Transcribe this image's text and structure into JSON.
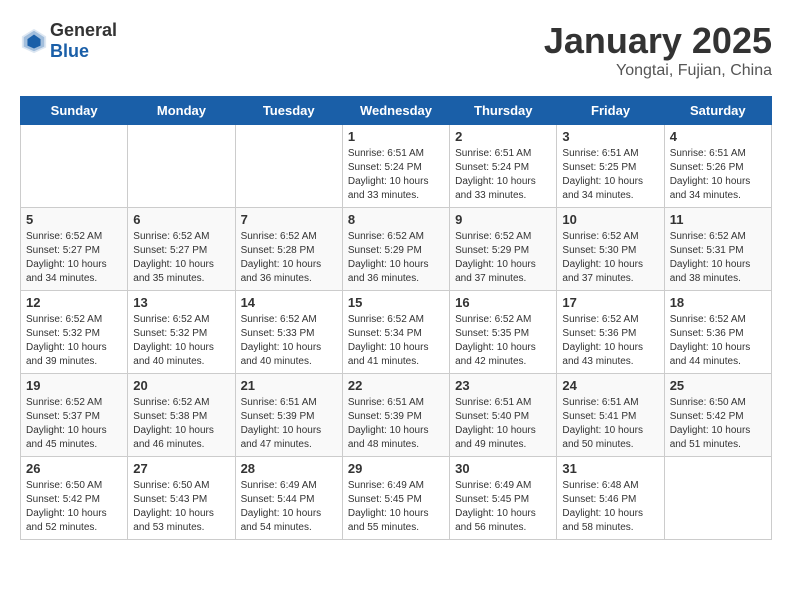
{
  "header": {
    "logo": {
      "general": "General",
      "blue": "Blue"
    },
    "title": "January 2025",
    "subtitle": "Yongtai, Fujian, China"
  },
  "calendar": {
    "weekdays": [
      "Sunday",
      "Monday",
      "Tuesday",
      "Wednesday",
      "Thursday",
      "Friday",
      "Saturday"
    ],
    "weeks": [
      [
        null,
        null,
        null,
        {
          "day": "1",
          "sunrise": "6:51 AM",
          "sunset": "5:24 PM",
          "daylight": "10 hours and 33 minutes."
        },
        {
          "day": "2",
          "sunrise": "6:51 AM",
          "sunset": "5:24 PM",
          "daylight": "10 hours and 33 minutes."
        },
        {
          "day": "3",
          "sunrise": "6:51 AM",
          "sunset": "5:25 PM",
          "daylight": "10 hours and 34 minutes."
        },
        {
          "day": "4",
          "sunrise": "6:51 AM",
          "sunset": "5:26 PM",
          "daylight": "10 hours and 34 minutes."
        }
      ],
      [
        {
          "day": "5",
          "sunrise": "6:52 AM",
          "sunset": "5:27 PM",
          "daylight": "10 hours and 34 minutes."
        },
        {
          "day": "6",
          "sunrise": "6:52 AM",
          "sunset": "5:27 PM",
          "daylight": "10 hours and 35 minutes."
        },
        {
          "day": "7",
          "sunrise": "6:52 AM",
          "sunset": "5:28 PM",
          "daylight": "10 hours and 36 minutes."
        },
        {
          "day": "8",
          "sunrise": "6:52 AM",
          "sunset": "5:29 PM",
          "daylight": "10 hours and 36 minutes."
        },
        {
          "day": "9",
          "sunrise": "6:52 AM",
          "sunset": "5:29 PM",
          "daylight": "10 hours and 37 minutes."
        },
        {
          "day": "10",
          "sunrise": "6:52 AM",
          "sunset": "5:30 PM",
          "daylight": "10 hours and 37 minutes."
        },
        {
          "day": "11",
          "sunrise": "6:52 AM",
          "sunset": "5:31 PM",
          "daylight": "10 hours and 38 minutes."
        }
      ],
      [
        {
          "day": "12",
          "sunrise": "6:52 AM",
          "sunset": "5:32 PM",
          "daylight": "10 hours and 39 minutes."
        },
        {
          "day": "13",
          "sunrise": "6:52 AM",
          "sunset": "5:32 PM",
          "daylight": "10 hours and 40 minutes."
        },
        {
          "day": "14",
          "sunrise": "6:52 AM",
          "sunset": "5:33 PM",
          "daylight": "10 hours and 40 minutes."
        },
        {
          "day": "15",
          "sunrise": "6:52 AM",
          "sunset": "5:34 PM",
          "daylight": "10 hours and 41 minutes."
        },
        {
          "day": "16",
          "sunrise": "6:52 AM",
          "sunset": "5:35 PM",
          "daylight": "10 hours and 42 minutes."
        },
        {
          "day": "17",
          "sunrise": "6:52 AM",
          "sunset": "5:36 PM",
          "daylight": "10 hours and 43 minutes."
        },
        {
          "day": "18",
          "sunrise": "6:52 AM",
          "sunset": "5:36 PM",
          "daylight": "10 hours and 44 minutes."
        }
      ],
      [
        {
          "day": "19",
          "sunrise": "6:52 AM",
          "sunset": "5:37 PM",
          "daylight": "10 hours and 45 minutes."
        },
        {
          "day": "20",
          "sunrise": "6:52 AM",
          "sunset": "5:38 PM",
          "daylight": "10 hours and 46 minutes."
        },
        {
          "day": "21",
          "sunrise": "6:51 AM",
          "sunset": "5:39 PM",
          "daylight": "10 hours and 47 minutes."
        },
        {
          "day": "22",
          "sunrise": "6:51 AM",
          "sunset": "5:39 PM",
          "daylight": "10 hours and 48 minutes."
        },
        {
          "day": "23",
          "sunrise": "6:51 AM",
          "sunset": "5:40 PM",
          "daylight": "10 hours and 49 minutes."
        },
        {
          "day": "24",
          "sunrise": "6:51 AM",
          "sunset": "5:41 PM",
          "daylight": "10 hours and 50 minutes."
        },
        {
          "day": "25",
          "sunrise": "6:50 AM",
          "sunset": "5:42 PM",
          "daylight": "10 hours and 51 minutes."
        }
      ],
      [
        {
          "day": "26",
          "sunrise": "6:50 AM",
          "sunset": "5:42 PM",
          "daylight": "10 hours and 52 minutes."
        },
        {
          "day": "27",
          "sunrise": "6:50 AM",
          "sunset": "5:43 PM",
          "daylight": "10 hours and 53 minutes."
        },
        {
          "day": "28",
          "sunrise": "6:49 AM",
          "sunset": "5:44 PM",
          "daylight": "10 hours and 54 minutes."
        },
        {
          "day": "29",
          "sunrise": "6:49 AM",
          "sunset": "5:45 PM",
          "daylight": "10 hours and 55 minutes."
        },
        {
          "day": "30",
          "sunrise": "6:49 AM",
          "sunset": "5:45 PM",
          "daylight": "10 hours and 56 minutes."
        },
        {
          "day": "31",
          "sunrise": "6:48 AM",
          "sunset": "5:46 PM",
          "daylight": "10 hours and 58 minutes."
        },
        null
      ]
    ]
  }
}
